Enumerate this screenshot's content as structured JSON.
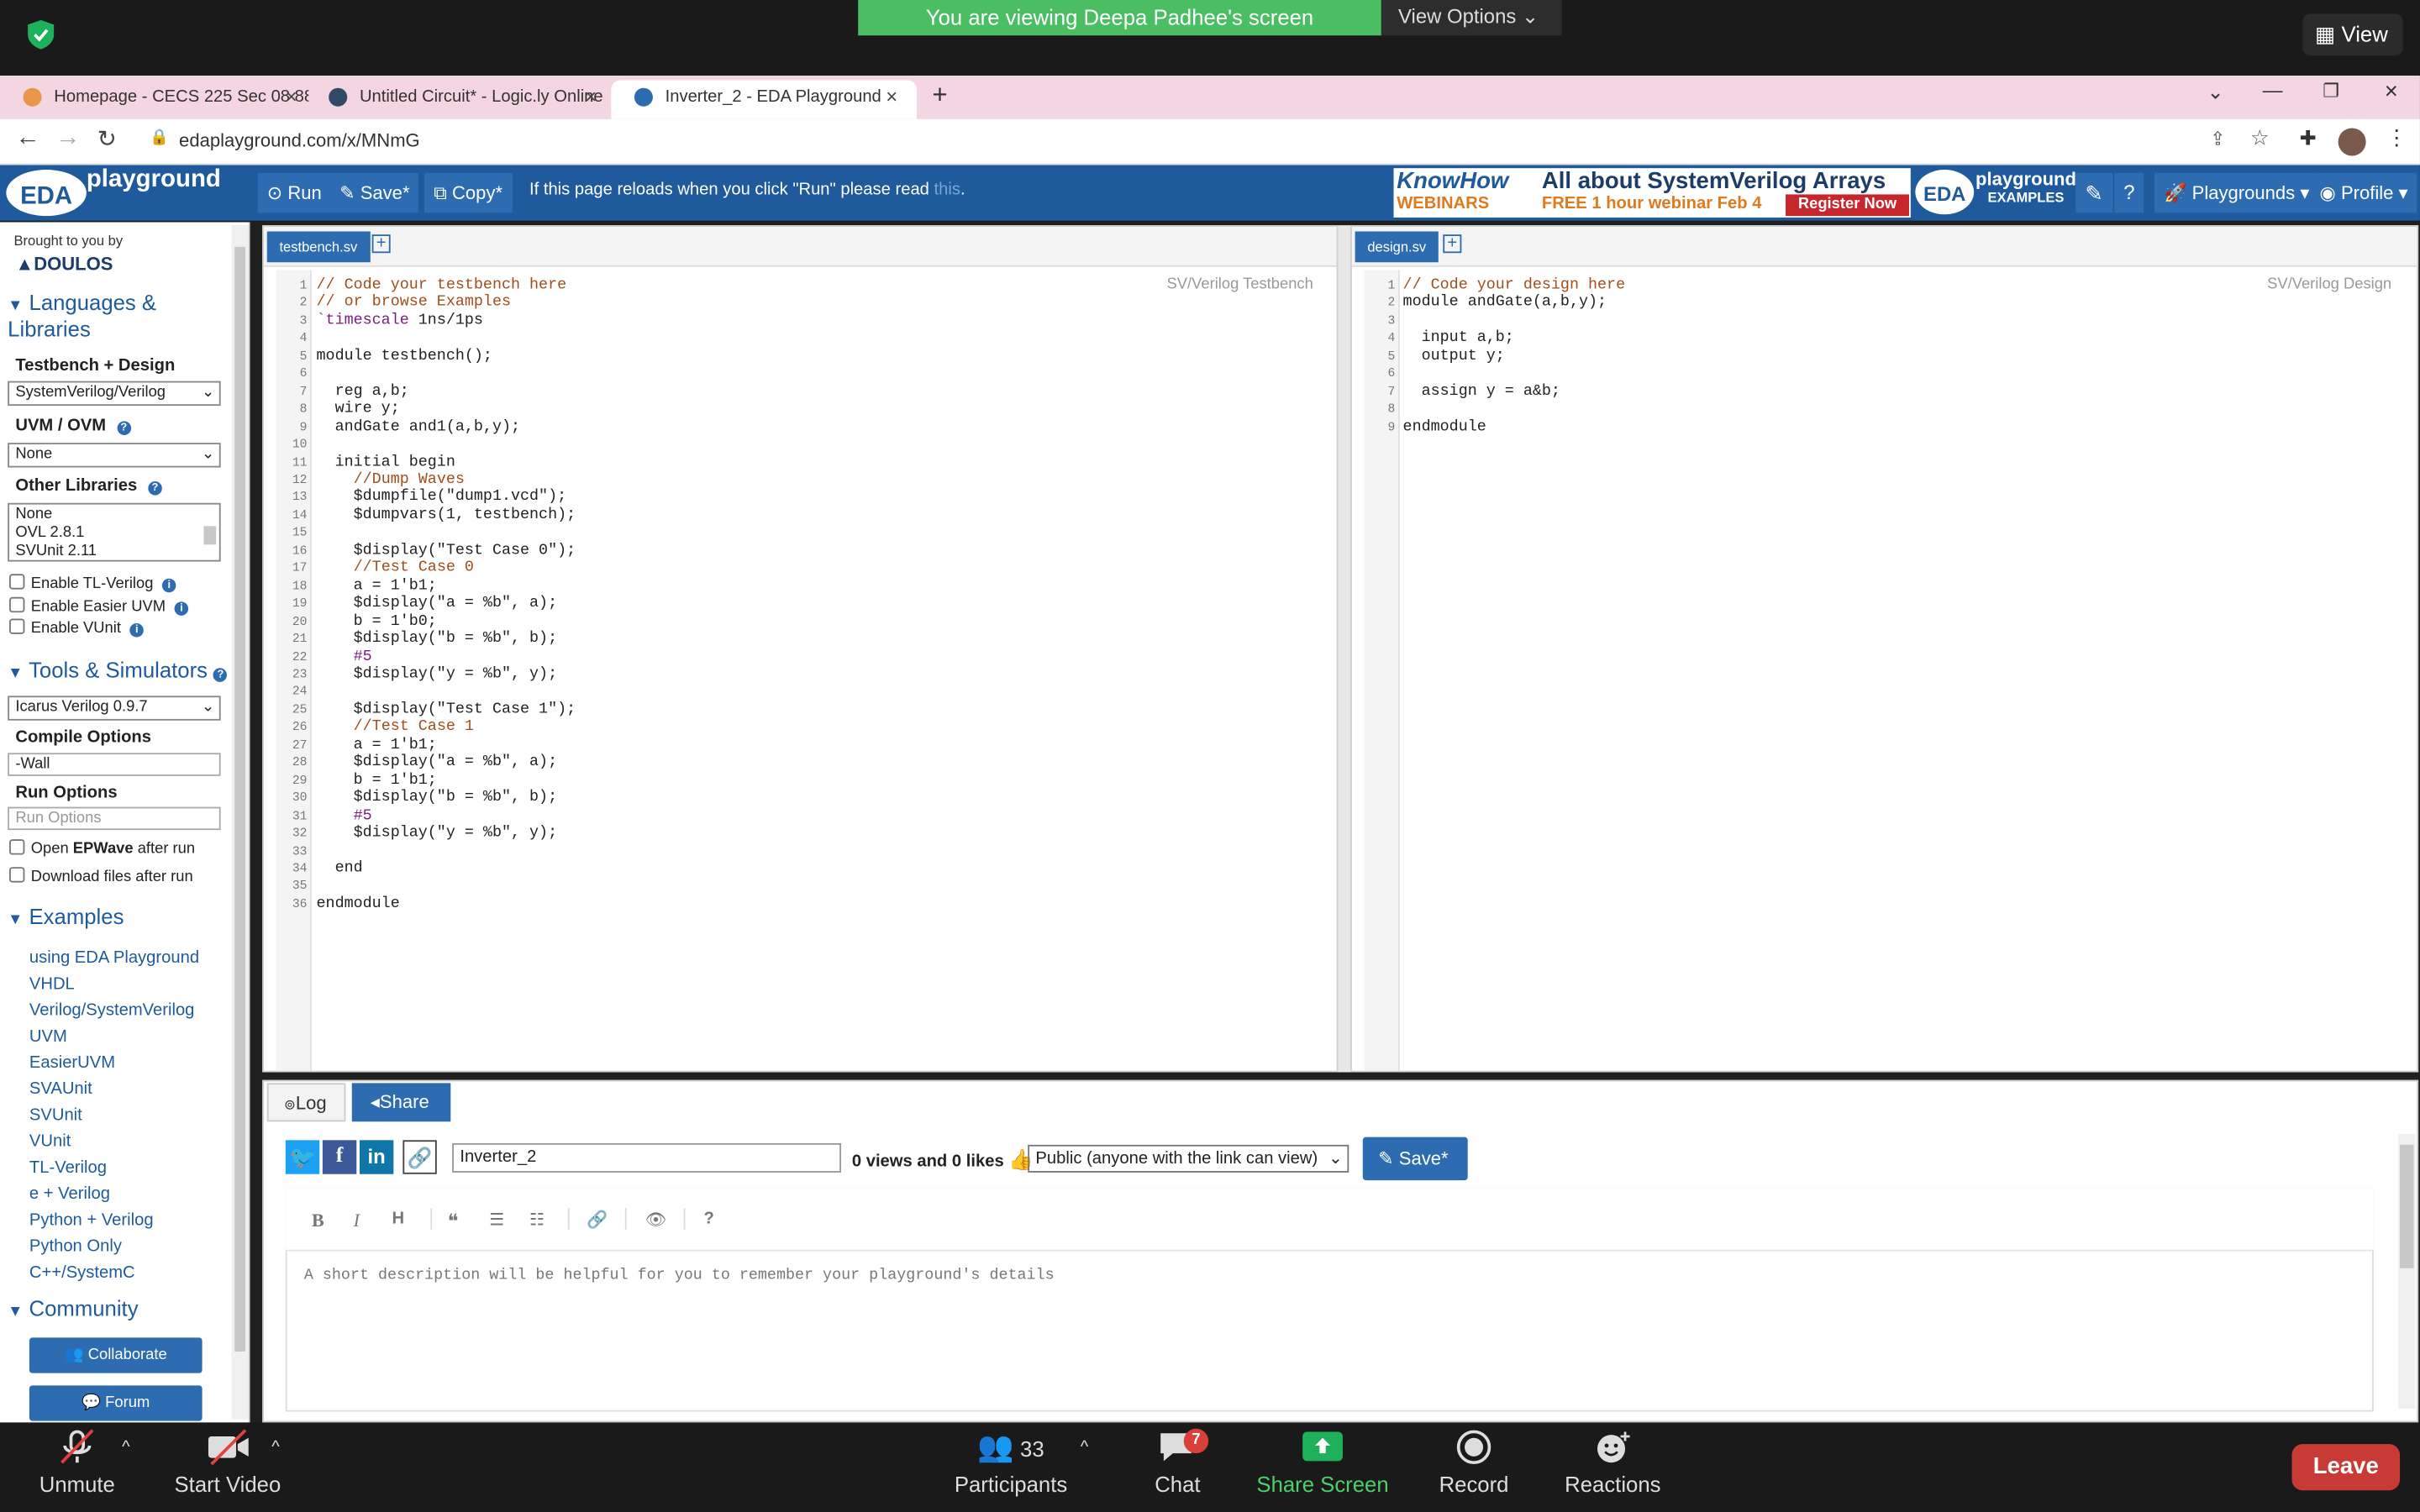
{
  "zoom": {
    "banner": "You are viewing Deepa Padhee's screen",
    "view_options": "View Options",
    "view_button": "View",
    "unmute": "Unmute",
    "start_video": "Start Video",
    "participants_label": "Participants",
    "participants_count": "33",
    "chat": "Chat",
    "chat_badge": "7",
    "share_screen": "Share Screen",
    "record": "Record",
    "reactions": "Reactions",
    "leave": "Leave"
  },
  "browser": {
    "tabs": [
      {
        "label": "Homepage - CECS 225 Sec 08 88",
        "active": false
      },
      {
        "label": "Untitled Circuit* - Logic.ly Online",
        "active": false
      },
      {
        "label": "Inverter_2 - EDA Playground",
        "active": true
      }
    ],
    "url": "edaplayground.com/x/MNmG"
  },
  "eda": {
    "logo_eda": "EDA",
    "logo_playground": "playground",
    "run": "Run",
    "save": "Save",
    "copy": "Copy",
    "reload_note": "If this page reloads when you click \"Run\" please read",
    "reload_link": "this",
    "ad": {
      "brand": "KnowHow",
      "webinars": "WEBINARS",
      "headline": "All about SystemVerilog Arrays",
      "sub": "FREE 1 hour webinar Feb 4",
      "cta": "Register Now"
    },
    "examples_logo_top": "playground",
    "examples_logo_bottom": "EXAMPLES",
    "playgrounds": "Playgrounds",
    "profile": "Profile"
  },
  "sidebar": {
    "brought": "Brought to you by",
    "doulos": "DOULOS",
    "languages_section": "Languages & Libraries",
    "testbench_design_label": "Testbench + Design",
    "testbench_design_value": "SystemVerilog/Verilog",
    "uvm_label": "UVM / OVM",
    "uvm_value": "None",
    "other_libraries_label": "Other Libraries",
    "other_libraries": [
      "None",
      "OVL 2.8.1",
      "SVUnit 2.11"
    ],
    "enable_tl": "Enable TL-Verilog",
    "enable_easier_uvm": "Enable Easier UVM",
    "enable_vunit": "Enable VUnit",
    "tools_section": "Tools & Simulators",
    "simulator_value": "Icarus Verilog 0.9.7",
    "compile_label": "Compile Options",
    "compile_value": "-Wall",
    "run_label": "Run Options",
    "run_placeholder": "Run Options",
    "open_epwave_pre": "Open ",
    "open_epwave_bold": "EPWave",
    "open_epwave_post": " after run",
    "download_files": "Download files after run",
    "examples_section": "Examples",
    "examples": [
      "using EDA Playground",
      "VHDL",
      "Verilog/SystemVerilog",
      "UVM",
      "EasierUVM",
      "SVAUnit",
      "SVUnit",
      "VUnit",
      "TL-Verilog",
      "e + Verilog",
      "Python + Verilog",
      "Python Only",
      "C++/SystemC"
    ],
    "community_section": "Community",
    "collaborate": "Collaborate",
    "forum": "Forum"
  },
  "testbench": {
    "tab": "testbench.sv",
    "mode": "SV/Verilog Testbench",
    "lines": [
      "// Code your testbench here",
      "// or browse Examples",
      "`timescale 1ns/1ps",
      "",
      "module testbench();",
      "",
      "  reg a,b;",
      "  wire y;",
      "  andGate and1(a,b,y);",
      "",
      "  initial begin",
      "    //Dump Waves",
      "    $dumpfile(\"dump1.vcd\");",
      "    $dumpvars(1, testbench);",
      "",
      "    $display(\"Test Case 0\");",
      "    //Test Case 0",
      "    a = 1'b1;",
      "    $display(\"a = %b\", a);",
      "    b = 1'b0;",
      "    $display(\"b = %b\", b);",
      "    #5",
      "    $display(\"y = %b\", y);",
      "",
      "    $display(\"Test Case 1\");",
      "    //Test Case 1",
      "    a = 1'b1;",
      "    $display(\"a = %b\", a);",
      "    b = 1'b1;",
      "    $display(\"b = %b\", b);",
      "    #5",
      "    $display(\"y = %b\", y);",
      "",
      "  end",
      "",
      "endmodule"
    ]
  },
  "design": {
    "tab": "design.sv",
    "mode": "SV/Verilog Design",
    "lines": [
      "// Code your design here",
      "module andGate(a,b,y);",
      "",
      "  input a,b;",
      "  output y;",
      "",
      "  assign y = a&b;",
      "",
      "endmodule"
    ]
  },
  "share_panel": {
    "log_tab": "Log",
    "share_tab": "Share",
    "playground_name": "Inverter_2",
    "views_likes": "0 views and 0 likes",
    "visibility": "Public (anyone with the link can view)",
    "save": "Save",
    "description_placeholder": "A short description will be helpful for you to remember your playground's details"
  }
}
